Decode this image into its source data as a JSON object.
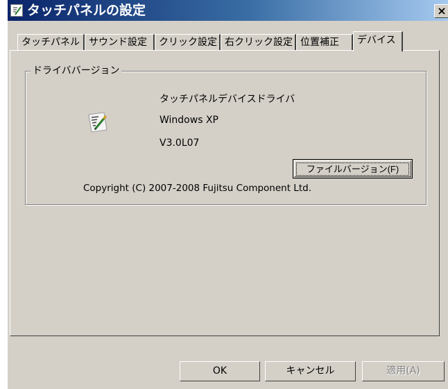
{
  "window": {
    "title": "タッチパネルの設定",
    "close_glyph": "×"
  },
  "tabs": [
    {
      "label": "タッチパネル"
    },
    {
      "label": "サウンド設定"
    },
    {
      "label": "クリック設定"
    },
    {
      "label": "右クリック設定"
    },
    {
      "label": "位置補正"
    },
    {
      "label": "デバイス"
    }
  ],
  "active_tab": "デバイス",
  "driver_group": {
    "legend": "ドライババージョン",
    "icon": "notepad-pen-icon",
    "driver_name": "タッチパネルデバイスドライバ",
    "os": "Windows XP",
    "version": "V3.0L07",
    "file_version_button": "ファイルバージョン(F)",
    "copyright": "Copyright (C) 2007-2008 Fujitsu Component Ltd."
  },
  "buttons": {
    "ok": "OK",
    "cancel": "キャンセル",
    "apply": "適用(A)"
  },
  "colors": {
    "face": "#d4d0c8",
    "title_start": "#0a246a",
    "title_end": "#a6caf0"
  }
}
